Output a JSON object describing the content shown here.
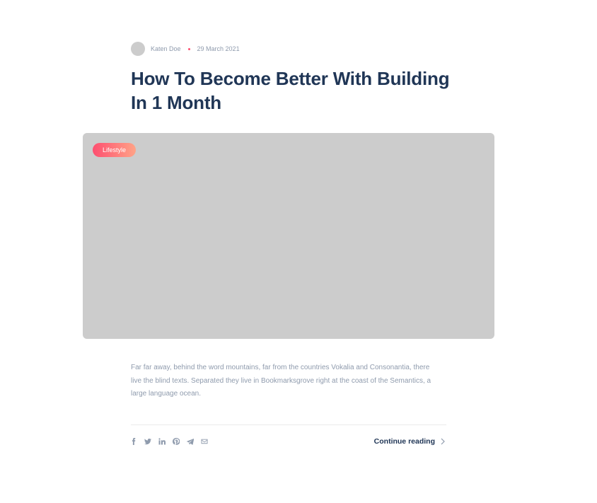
{
  "post": {
    "author": "Katen Doe",
    "date": "29 March 2021",
    "title": "How To Become Better With Building In 1 Month",
    "category": "Lifestyle",
    "excerpt": "Far far away, behind the word mountains, far from the countries Vokalia and Consonantia, there live the blind texts. Separated they live in Bookmarksgrove right at the coast of the Semantics, a large language ocean.",
    "continue_label": "Continue reading"
  },
  "share_icons": [
    "facebook-icon",
    "twitter-icon",
    "linkedin-icon",
    "pinterest-icon",
    "telegram-icon",
    "email-icon"
  ],
  "colors": {
    "accent_start": "#fe4f70",
    "accent_end": "#ffa387",
    "heading": "#203656",
    "muted": "#8f9bad",
    "image_placeholder": "#cccccc"
  }
}
